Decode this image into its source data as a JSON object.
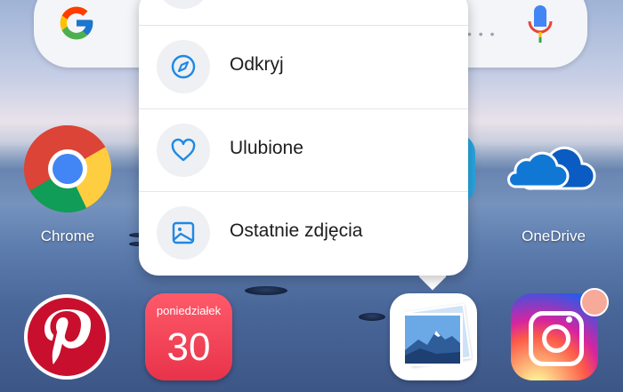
{
  "search_widget": {
    "logo": "google-g-icon",
    "voice": "microphone-icon"
  },
  "apps_row1": [
    {
      "label": "Chrome",
      "icon": "chrome-icon"
    },
    {
      "label": "OneDrive",
      "icon": "onedrive-icon"
    }
  ],
  "dock": [
    {
      "icon": "pinterest-icon"
    },
    {
      "icon": "calendar-icon",
      "day_label": "poniedziałek",
      "date_number": "30"
    },
    {
      "icon": "gallery-icon"
    },
    {
      "icon": "instagram-icon",
      "has_badge": true
    }
  ],
  "context_menu": {
    "items": [
      {
        "label": "Odkryj",
        "icon": "compass-icon"
      },
      {
        "label": "Ulubione",
        "icon": "heart-icon"
      },
      {
        "label": "Ostatnie zdjęcia",
        "icon": "image-icon"
      }
    ]
  },
  "colors": {
    "accent_blue": "#1e88e5",
    "menu_bg": "#ffffff",
    "icon_circle_bg": "#eef0f3"
  }
}
